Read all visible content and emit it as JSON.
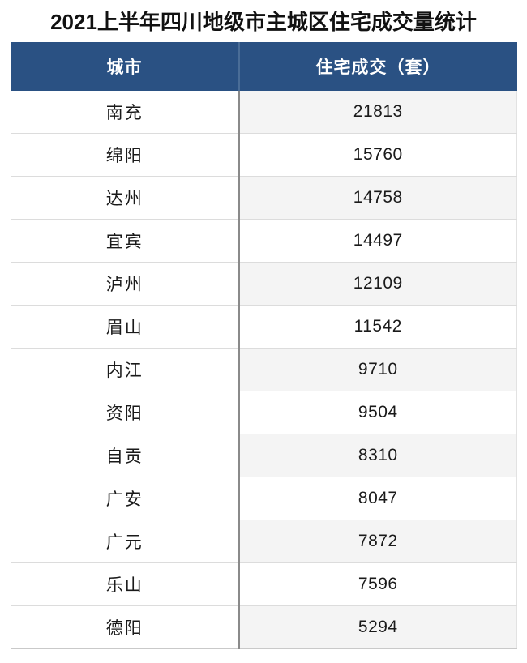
{
  "page": {
    "title": "2021上半年四川地级市主城区住宅成交量统计"
  },
  "colors": {
    "header_bg": "#2a5183",
    "header_text": "#ffffff",
    "title_text": "#111111",
    "row_alt_bg": "#f4f4f4",
    "row_bg": "#ffffff",
    "grid_line": "#dcdcdc",
    "column_divider": "#8a8a8a"
  },
  "table": {
    "columns": [
      {
        "key": "city",
        "label": "城市"
      },
      {
        "key": "value",
        "label": "住宅成交（套）"
      }
    ],
    "rows": [
      {
        "city": "南充",
        "value": "21813"
      },
      {
        "city": "绵阳",
        "value": "15760"
      },
      {
        "city": "达州",
        "value": "14758"
      },
      {
        "city": "宜宾",
        "value": "14497"
      },
      {
        "city": "泸州",
        "value": "12109"
      },
      {
        "city": "眉山",
        "value": "11542"
      },
      {
        "city": "内江",
        "value": "9710"
      },
      {
        "city": "资阳",
        "value": "9504"
      },
      {
        "city": "自贡",
        "value": "8310"
      },
      {
        "city": "广安",
        "value": "8047"
      },
      {
        "city": "广元",
        "value": "7872"
      },
      {
        "city": "乐山",
        "value": "7596"
      },
      {
        "city": "德阳",
        "value": "5294"
      }
    ]
  },
  "chart_data": {
    "type": "table",
    "title": "2021上半年四川地级市主城区住宅成交量统计",
    "xlabel": "城市",
    "ylabel": "住宅成交（套）",
    "categories": [
      "南充",
      "绵阳",
      "达州",
      "宜宾",
      "泸州",
      "眉山",
      "内江",
      "资阳",
      "自贡",
      "广安",
      "广元",
      "乐山",
      "德阳"
    ],
    "values": [
      21813,
      15760,
      14758,
      14497,
      12109,
      11542,
      9710,
      9504,
      8310,
      8047,
      7872,
      7596,
      5294
    ],
    "unit": "套",
    "sorted": "descending"
  }
}
